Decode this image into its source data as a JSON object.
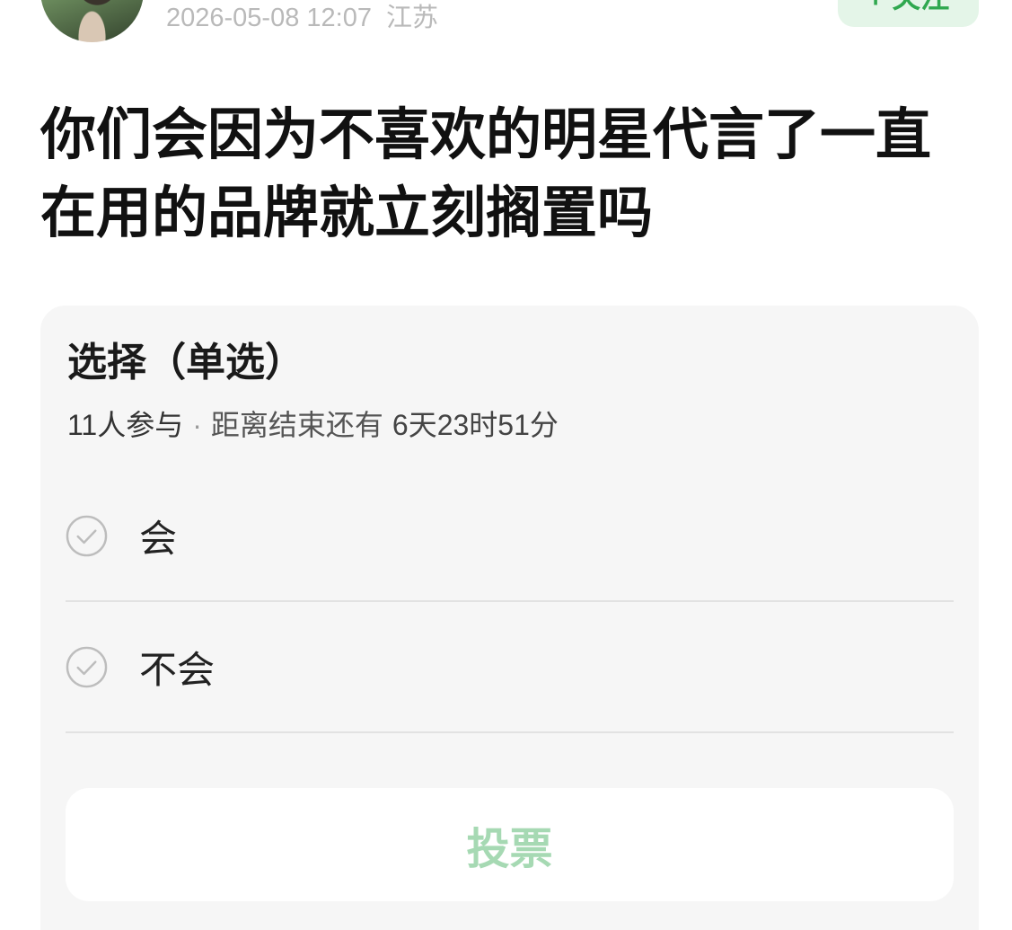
{
  "header": {
    "timestamp": "2026-05-08 12:07",
    "location": "江苏",
    "follow_label": "+ 关注"
  },
  "post": {
    "title": "你们会因为不喜欢的明星代言了一直在用的品牌就立刻搁置吗"
  },
  "poll": {
    "heading": "选择（单选）",
    "participants": "11人参与",
    "separator": "·",
    "countdown_label": "距离结束还有",
    "countdown_value": "6天23时51分",
    "options": [
      {
        "label": "会",
        "icon": "check-circle-icon",
        "selected": false
      },
      {
        "label": "不会",
        "icon": "check-circle-icon",
        "selected": false
      }
    ],
    "vote_label": "投票"
  },
  "colors": {
    "accent": "#2fa84f",
    "follow_bg": "#e4f5e8",
    "vote_text": "#a6d9b3",
    "card_bg": "#f6f6f6",
    "icon": "#bdbdbd"
  }
}
